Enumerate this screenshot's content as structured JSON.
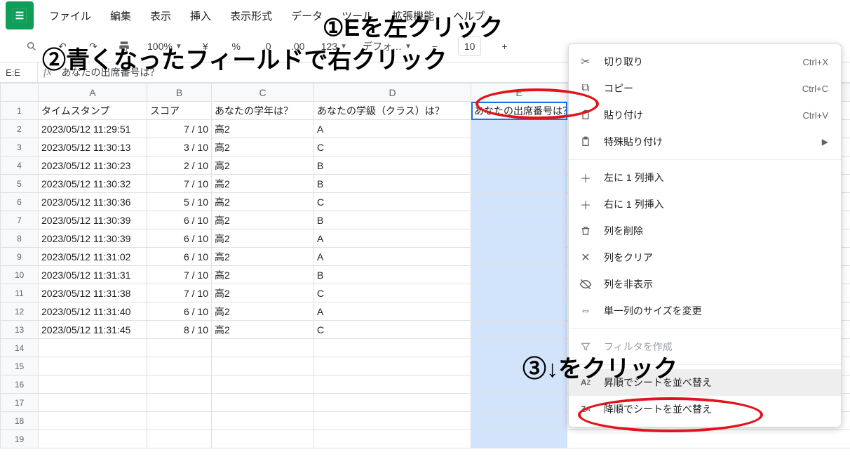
{
  "menus": {
    "file": "ファイル",
    "edit": "編集",
    "view": "表示",
    "insert": "挿入",
    "format": "表示形式",
    "data": "データ",
    "tools": "ツール",
    "extensions": "拡張機能",
    "help": "ヘルプ"
  },
  "toolbar": {
    "zoom": "100%",
    "currency": "¥",
    "percent": "%",
    "dec_dec": ".0",
    "inc_dec": ".00",
    "num123": "123",
    "font_dd": "デフォ…",
    "font_size": "10"
  },
  "namebox": "E:E",
  "fx_label": "fx",
  "formula": "あなたの出席番号は？",
  "columns": [
    "A",
    "B",
    "C",
    "D",
    "E"
  ],
  "headers": {
    "A": "タイムスタンプ",
    "B": "スコア",
    "C": "あなたの学年は？",
    "D": "あなたの学級（クラス）は？",
    "E": "あなたの出席番号は？"
  },
  "rows": [
    {
      "A": "2023/05/12 11:29:51",
      "B": "7 / 10",
      "C": "高2",
      "D": "A"
    },
    {
      "A": "2023/05/12 11:30:13",
      "B": "3 / 10",
      "C": "高2",
      "D": "C"
    },
    {
      "A": "2023/05/12 11:30:23",
      "B": "2 / 10",
      "C": "高2",
      "D": "B"
    },
    {
      "A": "2023/05/12 11:30:32",
      "B": "7 / 10",
      "C": "高2",
      "D": "B"
    },
    {
      "A": "2023/05/12 11:30:36",
      "B": "5 / 10",
      "C": "高2",
      "D": "C"
    },
    {
      "A": "2023/05/12 11:30:39",
      "B": "6 / 10",
      "C": "高2",
      "D": "B"
    },
    {
      "A": "2023/05/12 11:30:39",
      "B": "6 / 10",
      "C": "高2",
      "D": "A"
    },
    {
      "A": "2023/05/12 11:31:02",
      "B": "6 / 10",
      "C": "高2",
      "D": "A"
    },
    {
      "A": "2023/05/12 11:31:31",
      "B": "7 / 10",
      "C": "高2",
      "D": "B"
    },
    {
      "A": "2023/05/12 11:31:38",
      "B": "7 / 10",
      "C": "高2",
      "D": "C"
    },
    {
      "A": "2023/05/12 11:31:40",
      "B": "6 / 10",
      "C": "高2",
      "D": "A"
    },
    {
      "A": "2023/05/12 11:31:45",
      "B": "8 / 10",
      "C": "高2",
      "D": "C"
    }
  ],
  "blank_rows": [
    14,
    15,
    16,
    17,
    18,
    19
  ],
  "ctx": {
    "cut": "切り取り",
    "cut_sc": "Ctrl+X",
    "copy": "コピー",
    "copy_sc": "Ctrl+C",
    "paste": "貼り付け",
    "paste_sc": "Ctrl+V",
    "paste_special": "特殊貼り付け",
    "insert_left": "左に 1 列挿入",
    "insert_right": "右に 1 列挿入",
    "delete_col": "列を削除",
    "clear_col": "列をクリア",
    "hide_col": "列を非表示",
    "resize_col": "単一列のサイズを変更",
    "create_filter": "フィルタを作成",
    "sort_asc": "昇順でシートを並べ替え",
    "sort_desc": "降順でシートを並べ替え"
  },
  "annotations": {
    "a1": "①Eを左クリック",
    "a2": "②青くなったフィールドで右クリック",
    "a3": "③↓をクリック"
  }
}
